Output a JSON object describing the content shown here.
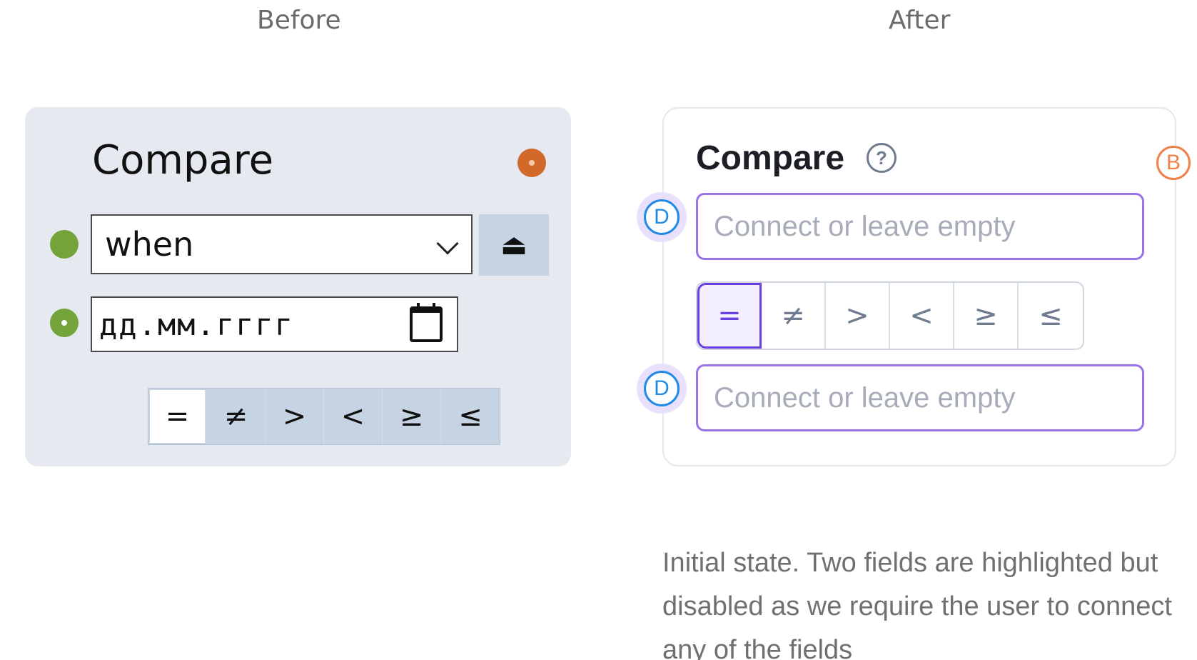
{
  "before": {
    "label": "Before",
    "title": "Compare",
    "select_value": "when",
    "eject_icon": "⏏",
    "date_placeholder": "дд.мм.гггг",
    "operators": [
      "=",
      "≠",
      ">",
      "<",
      "≥",
      "≤"
    ],
    "active_operator": "="
  },
  "after": {
    "label": "After",
    "title": "Compare",
    "help_icon": "?",
    "badge_b": "B",
    "badge_d": "D",
    "field_placeholder": "Connect or leave empty",
    "operators": [
      "=",
      "≠",
      ">",
      "<",
      "≥",
      "≤"
    ],
    "active_operator": "=",
    "caption": "Initial state. Two fields are highlighted but disabled as we require the user to connect any of the fields"
  },
  "colors": {
    "before_bg": "#e6eaf0",
    "green_dot": "#73a33a",
    "orange_dot": "#d1692a",
    "accent_purple": "#9b73e8",
    "active_purple": "#6a3fe0",
    "badge_blue": "#1e8be6",
    "badge_orange": "#f0804a"
  }
}
